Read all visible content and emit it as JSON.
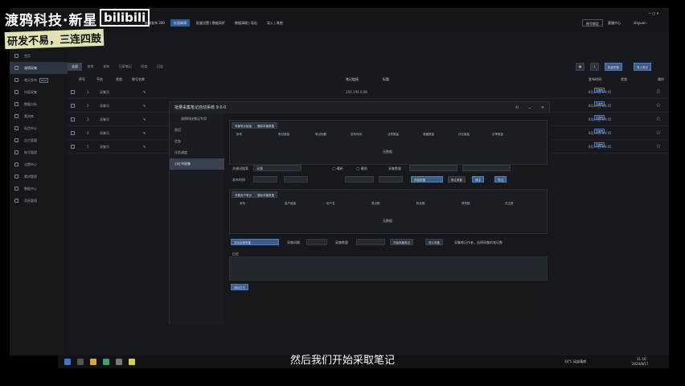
{
  "watermark": {
    "line1": "渡鸦科技·新星",
    "line2": "研发不易，三连四鼓",
    "logo": "bilibili"
  },
  "topbar": {
    "items": [
      "批量发布 300",
      "批量编辑",
      "批量设置 | 数据同步",
      "数据清理 | 导出",
      "导入 | 其他"
    ],
    "right_buttons": [
      "账号绑定",
      "客服中心",
      "设置",
      "帮助"
    ],
    "user": "zhiyuan"
  },
  "sidebar": {
    "items": [
      {
        "label": "首页",
        "tag": ""
      },
      {
        "label": "渡鸦采集",
        "tag": ""
      },
      {
        "label": "笔记发布",
        "tag": "NEW"
      },
      {
        "label": "内容采集",
        "tag": ""
      },
      {
        "label": "数据分析",
        "tag": ""
      },
      {
        "label": "素材库",
        "tag": ""
      },
      {
        "label": "私信中心",
        "tag": ""
      },
      {
        "label": "员工管理",
        "tag": ""
      },
      {
        "label": "账号管理",
        "tag": ""
      },
      {
        "label": "设置中心",
        "tag": ""
      },
      {
        "label": "素材管理",
        "tag": ""
      },
      {
        "label": "数据中心",
        "tag": ""
      },
      {
        "label": "消息管理",
        "tag": ""
      }
    ]
  },
  "main": {
    "tabs": [
      "全部",
      "待发",
      "发布",
      "已采笔记",
      "任务",
      "日志"
    ],
    "toolbar_buttons": [
      "批量采集",
      "导入笔记"
    ],
    "columns": [
      "序号",
      "平台",
      "状态",
      "账号名称",
      "笔记链接",
      "标题",
      "发布时间",
      "状态",
      "操作"
    ],
    "rows": [
      {
        "no": "1",
        "name": "采集号",
        "link": "156.194.0.08",
        "time": "8月17日 09:45",
        "status": "已发布"
      },
      {
        "no": "2",
        "name": "采集号",
        "link": "156.194.0.08",
        "time": "8月17日 09:45",
        "status": "已发布"
      },
      {
        "no": "3",
        "name": "采集号",
        "link": "",
        "time": "8月17日 09:45",
        "status": "已发布"
      },
      {
        "no": "4",
        "name": "采集号",
        "link": "",
        "time": "8月17日 09:45",
        "status": "已发布"
      },
      {
        "no": "5",
        "name": "采集号",
        "link": "",
        "time": "8月17日 09:45",
        "status": "已发布"
      }
    ]
  },
  "modal": {
    "title": "批量采集笔记自动系统 9.0.0",
    "nav_title": "渡鸦科技笔记专用",
    "nav_items": [
      "首页",
      "任务",
      "任务调度",
      "小红书采集"
    ],
    "section1_tabs": [
      "采集笔记链接",
      "删除采集数据"
    ],
    "table1_cols": [
      "序号",
      "笔记链接",
      "笔记标题",
      "发布时间",
      "点赞数量",
      "收藏数量",
      "评论数量",
      "分享数量"
    ],
    "empty1": "无数据",
    "keyword_label": "关键词搜索",
    "keyword_value": "采集",
    "radio1": "最新",
    "radio2": "最热",
    "count_label": "采集数量",
    "filter_label": "发布时间",
    "buttons_row": [
      "开始采集",
      "停止采集",
      "清空",
      "导出"
    ],
    "section2_tabs": [
      "采集用户笔记",
      "删除采集数据"
    ],
    "table2_cols": [
      "序号",
      "用户链接",
      "用户名",
      "笔记数",
      "粉丝数",
      "获赞数",
      "关注数"
    ],
    "empty2": "无数据",
    "bottom_buttons": [
      "启动全部采集",
      "采集间隔",
      "采集数量",
      "开始采集笔记",
      "停止采集",
      "采集笔记作者，选择采集的笔记数"
    ],
    "log_label": "日志",
    "clear_button": "清除日志"
  },
  "subtitle": "然后我们开始采取笔记",
  "taskbar": {
    "weather": "34°C 局部晴朗",
    "time": "11:16",
    "date": "2024/8/17"
  }
}
